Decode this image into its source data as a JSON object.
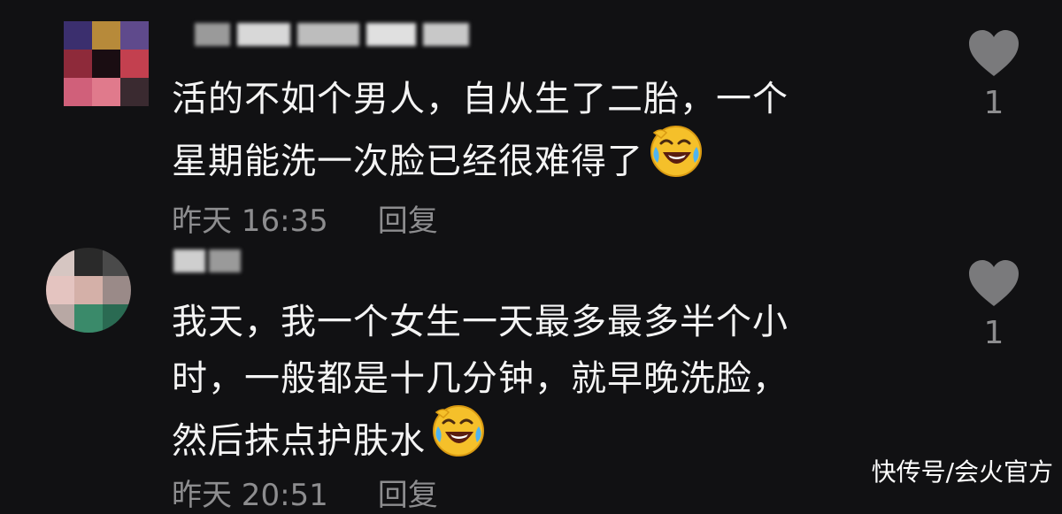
{
  "comments": [
    {
      "text_lines": [
        "活的不如个男人，自从生了二胎，一个",
        "星期能洗一次脸已经很难得了"
      ],
      "time": "昨天 16:35",
      "reply_label": "回复",
      "like_count": "1",
      "emoji": "rofl-emoji"
    },
    {
      "text_lines": [
        "我天，我一个女生一天最多最多半个小",
        "时，一般都是十几分钟，就早晚洗脸，",
        "然后抹点护肤水"
      ],
      "time": "昨天 20:51",
      "reply_label": "回复",
      "like_count": "1",
      "emoji": "rofl-emoji"
    }
  ],
  "watermark": "快传号/会火官方",
  "colors": {
    "background": "#111113",
    "text": "#f4f4f4",
    "meta": "#8d8d8f",
    "heart": "#7a7a7c"
  }
}
